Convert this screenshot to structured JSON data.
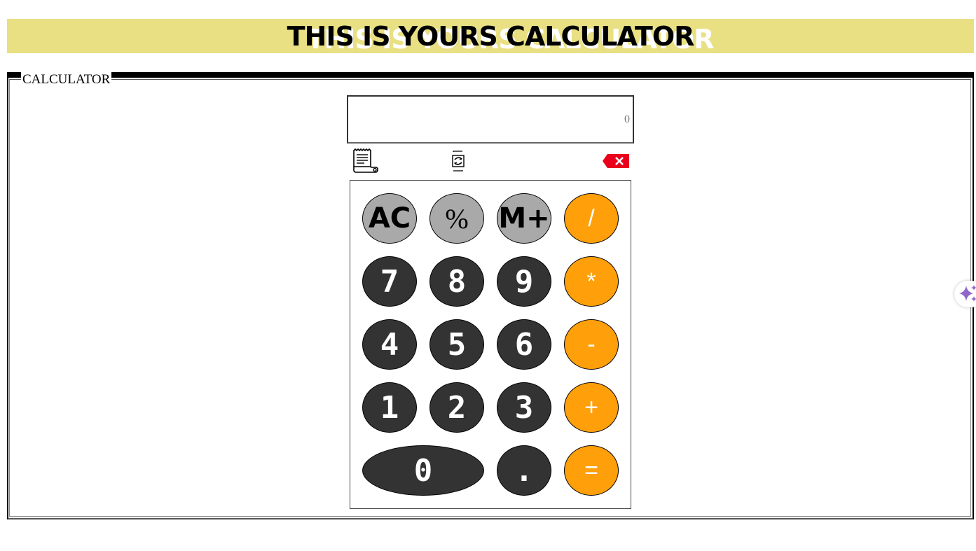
{
  "header": {
    "title": "THIS IS YOURS CALCULATOR",
    "background": "#e8e083"
  },
  "calculator": {
    "legend": "CALCULATOR",
    "display_value": "0",
    "toolbar": {
      "history_icon": "receipt-icon",
      "convert_icon": "converter-icon",
      "backspace_icon": "backspace-icon"
    },
    "keys": {
      "ac": "AC",
      "percent": "%",
      "memory_plus": "M+",
      "divide": "/",
      "seven": "7",
      "eight": "8",
      "nine": "9",
      "multiply": "*",
      "four": "4",
      "five": "5",
      "six": "6",
      "minus": "-",
      "one": "1",
      "two": "2",
      "three": "3",
      "plus": "+",
      "zero": "0",
      "dot": ".",
      "equals": "="
    },
    "colors": {
      "function_key": "#a9a9a9",
      "number_key": "#333333",
      "operator_key": "#ff9f0a"
    }
  },
  "side_widget": {
    "icon": "sparkle-icon"
  }
}
